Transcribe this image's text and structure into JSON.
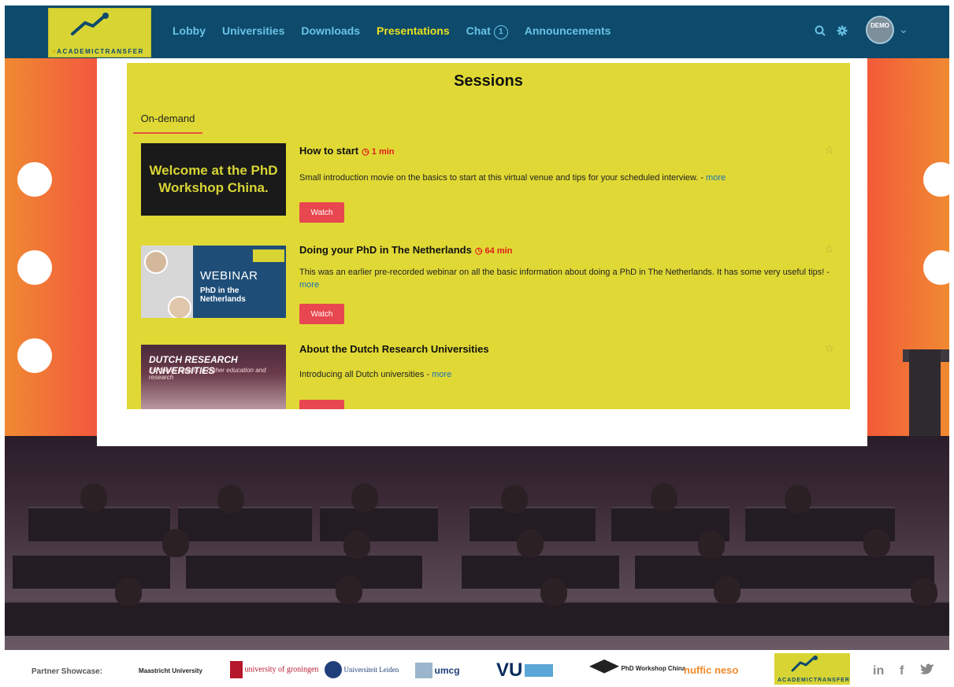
{
  "header": {
    "logo_text": "ACADEMICTRANSFER",
    "nav": [
      {
        "label": "Lobby"
      },
      {
        "label": "Universities"
      },
      {
        "label": "Downloads"
      },
      {
        "label": "Presentations",
        "active": true
      },
      {
        "label": "Chat",
        "badge": "1"
      },
      {
        "label": "Announcements"
      }
    ],
    "icons": [
      "search-icon",
      "gear-icon"
    ],
    "avatar_text": "DEMO"
  },
  "sessions": {
    "title": "Sessions",
    "tab": "On-demand",
    "items": [
      {
        "title": "How to start",
        "duration": "1 min",
        "description": "Small introduction movie on the basics to start at this virtual venue and tips for your scheduled interview. - ",
        "more": "more",
        "watch": "Watch",
        "thumb_text": "Welcome at the PhD Workshop China."
      },
      {
        "title": "Doing your PhD in The Netherlands",
        "duration": "64 min",
        "description": "This was an earlier pre-recorded webinar on all the basic information about doing a PhD in The Netherlands. It has some very useful tips! - ",
        "more": "more",
        "watch": "Watch",
        "thumb_line1": "WEBINAR",
        "thumb_line2": "PhD in the Netherlands"
      },
      {
        "title": "About the Dutch Research Universities",
        "description": "Introducing all Dutch universities - ",
        "more": "more",
        "thumb_line1": "DUTCH RESEARCH UNIVERSITIES",
        "thumb_line2": "European leaders in higher education and research"
      }
    ]
  },
  "footer": {
    "label": "Partner Showcase:",
    "partners": [
      "Maastricht University",
      "university of groningen",
      "Universiteit Leiden",
      "umcg",
      "VU",
      "PhD Workshop China",
      "nuffic neso",
      "ACADEMICTRANSFER"
    ],
    "social": [
      "in",
      "f"
    ]
  },
  "colors": {
    "header_bg": "#0d4a6b",
    "nav": "#69c3e6",
    "nav_active": "#e9e01f",
    "panel_yellow": "#e0d935",
    "watch": "#e8474f",
    "duration": "#e01c1c"
  }
}
